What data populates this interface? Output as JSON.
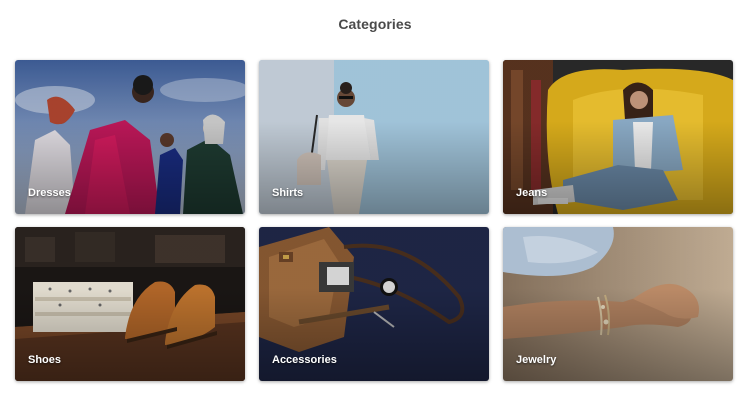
{
  "page": {
    "title": "Categories"
  },
  "categories": [
    {
      "label": "Dresses",
      "icon": "dresses-photo"
    },
    {
      "label": "Shirts",
      "icon": "shirts-photo"
    },
    {
      "label": "Jeans",
      "icon": "jeans-photo"
    },
    {
      "label": "Shoes",
      "icon": "shoes-photo"
    },
    {
      "label": "Accessories",
      "icon": "accessories-photo"
    },
    {
      "label": "Jewelry",
      "icon": "jewelry-photo"
    }
  ],
  "colors": {
    "title_text": "#4a4a4a",
    "label_text": "#ffffff",
    "background": "#ffffff"
  }
}
